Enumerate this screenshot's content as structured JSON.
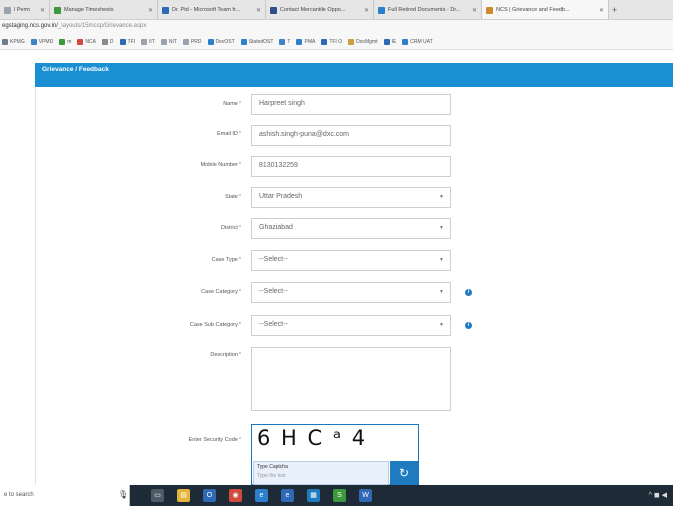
{
  "browser": {
    "tabs": [
      {
        "label": "l Perm",
        "color": "#9aa3ad",
        "width": 50
      },
      {
        "label": "Manage Timesheets",
        "color": "#3c9a3c",
        "width": 108
      },
      {
        "label": "Dr. Ptd - Microsoft Team fr...",
        "color": "#2f68b5",
        "width": 108
      },
      {
        "label": "Contact Mercantile Oppo...",
        "color": "#2d4f8c",
        "width": 108
      },
      {
        "label": "Full Retired Documents - Dr...",
        "color": "#2c7fcc",
        "width": 108
      },
      {
        "label": "NCS | Grievance and Feedb...",
        "color": "#cc8a2c",
        "width": 127
      }
    ],
    "address": {
      "host": "egstaging.ncs.gov.in/",
      "path": "_layouts/15/ncsp/Grievance.aspx"
    },
    "bookmarks": [
      {
        "label": "KPMG",
        "color": "#6b7d8f"
      },
      {
        "label": "VPMD",
        "color": "#3e83c9"
      },
      {
        "label": "m",
        "color": "#3c9a3c"
      },
      {
        "label": "NCA",
        "color": "#d04b3c"
      },
      {
        "label": "D",
        "color": "#8a8a8a"
      },
      {
        "label": "TFI",
        "color": "#2f68b5"
      },
      {
        "label": "IIT",
        "color": "#9aa3ad"
      },
      {
        "label": "NIT",
        "color": "#9aa3ad"
      },
      {
        "label": "PRD",
        "color": "#9aa3ad"
      },
      {
        "label": "DevOST",
        "color": "#2c7fcc"
      },
      {
        "label": "StatedOST",
        "color": "#2c7fcc"
      },
      {
        "label": "T",
        "color": "#3e83c9"
      },
      {
        "label": "PMA",
        "color": "#2c7fcc"
      },
      {
        "label": "TFI O",
        "color": "#2f68b5"
      },
      {
        "label": "DocMgmt",
        "color": "#c9a03e"
      },
      {
        "label": "IE",
        "color": "#2f68b5"
      },
      {
        "label": "CRM UAT",
        "color": "#2c7fcc"
      }
    ]
  },
  "panel": {
    "title": "Grievance / Feedback"
  },
  "form": {
    "name": {
      "label": "Name",
      "value": "Harpreet singh"
    },
    "email": {
      "label": "Email ID",
      "value": "ashish.singh-puna@dxc.com"
    },
    "mobile": {
      "label": "Mobile Number",
      "value": "8130132259"
    },
    "state": {
      "label": "State",
      "value": "Uttar Pradesh"
    },
    "district": {
      "label": "District",
      "value": "Ghaziabad"
    },
    "case_type": {
      "label": "Case Type",
      "value": "--Select--"
    },
    "case_category": {
      "label": "Case Category",
      "value": "--Select--"
    },
    "case_sub_category": {
      "label": "Case Sub Category",
      "value": "--Select--"
    },
    "description": {
      "label": "Description",
      "value": ""
    },
    "security": {
      "label": "Enter Security Code",
      "captcha": "6 H C ᵃ 4",
      "type_label": "Type Captcha",
      "placeholder": "Type the text"
    },
    "required_mark": "*"
  },
  "taskbar": {
    "search_text": "e to search",
    "apps": [
      {
        "name": "task-view",
        "color": "#4f5a66",
        "glyph": "▭"
      },
      {
        "name": "file-explorer",
        "color": "#e4b43a",
        "glyph": "▤"
      },
      {
        "name": "outlook",
        "color": "#2f68b5",
        "glyph": "O"
      },
      {
        "name": "chrome",
        "color": "#d04b3c",
        "glyph": "◉"
      },
      {
        "name": "edge",
        "color": "#2c7fcc",
        "glyph": "e"
      },
      {
        "name": "ie",
        "color": "#2f68b5",
        "glyph": "e"
      },
      {
        "name": "app",
        "color": "#1f7bc0",
        "glyph": "▦"
      },
      {
        "name": "teams",
        "color": "#3c9a3c",
        "glyph": "S"
      },
      {
        "name": "word",
        "color": "#2f68b5",
        "glyph": "W"
      }
    ],
    "tray": "^ ◼ ◀"
  }
}
